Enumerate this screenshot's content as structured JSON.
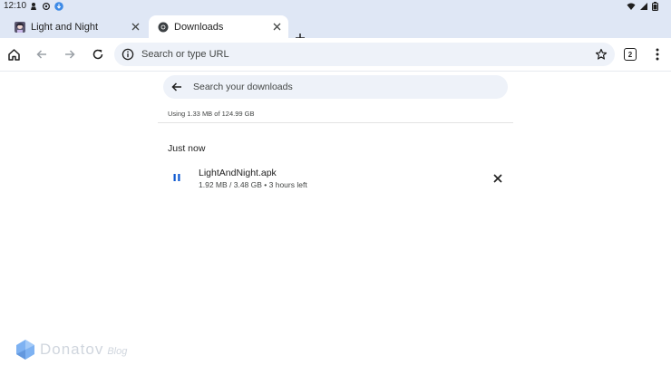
{
  "status_bar": {
    "time": "12:10",
    "left_icons": [
      "person-icon",
      "gear-icon",
      "download-notification-icon"
    ],
    "right_icons": [
      "wifi-icon",
      "signal-icon",
      "battery-icon"
    ]
  },
  "tabs": [
    {
      "title": "Light and Night",
      "active": false,
      "favicon": "anime-avatar-icon"
    },
    {
      "title": "Downloads",
      "active": true,
      "favicon": "chrome-icon"
    }
  ],
  "toolbar": {
    "address_placeholder": "Search or type URL",
    "tab_count": "2"
  },
  "downloads": {
    "search_placeholder": "Search your downloads",
    "storage_text": "Using 1.33 MB of 124.99 GB",
    "section_header": "Just now",
    "items": [
      {
        "filename": "LightAndNight.apk",
        "progress_text": "1.92 MB / 3.48 GB • 3 hours left",
        "state": "downloading"
      }
    ]
  },
  "watermark": {
    "text": "Donatov",
    "sub": "Blog"
  },
  "colors": {
    "accent": "#0b57d0",
    "chrome_bg": "#dfe7f5",
    "pill_bg": "#eef2f9"
  }
}
